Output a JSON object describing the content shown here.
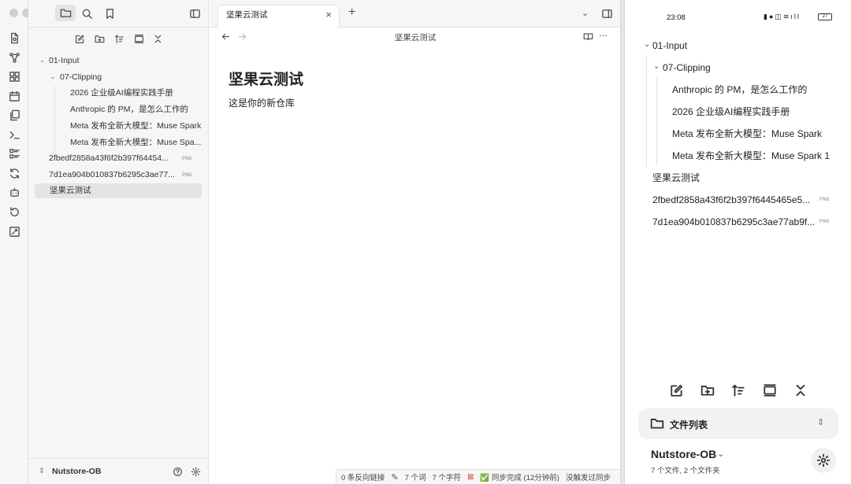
{
  "tab": {
    "title": "坚果云测试"
  },
  "note": {
    "header_title": "坚果云测试",
    "heading": "坚果云测试",
    "body": "这是你的新仓库"
  },
  "tree": {
    "folder1": "01-Input",
    "folder2": "07-Clipping",
    "files": [
      "2026 企业级AI编程实践手册",
      "Anthropic 的 PM，是怎么工作的",
      "Meta 发布全新大模型：Muse Spark",
      "Meta 发布全新大模型：Muse Spa..."
    ],
    "images": [
      {
        "name": "2fbedf2858a43f6f2b397f64454...",
        "ext": "PNG"
      },
      {
        "name": "7d1ea904b010837b6295c3ae77...",
        "ext": "PNG"
      }
    ],
    "selected": "坚果云测试"
  },
  "vault": {
    "name": "Nutstore-OB"
  },
  "status": {
    "backlinks": "0 条反向链接",
    "words": "7 个词",
    "chars": "7 个字符",
    "sync": "✅ 同步完成 (12分钟前)",
    "sync2": "没触发过同步"
  },
  "mobile": {
    "time": "23:08",
    "battery": "27",
    "folder1": "01-Input",
    "folder2": "07-Clipping",
    "files": [
      "Anthropic 的 PM，是怎么工作的",
      "2026 企业级AI编程实践手册",
      "Meta 发布全新大模型：Muse Spark",
      "Meta 发布全新大模型：Muse Spark 1"
    ],
    "root_note": "坚果云测试",
    "images": [
      {
        "name": "2fbedf2858a43f6f2b397f6445465e5...",
        "ext": "PNG"
      },
      {
        "name": "7d1ea904b010837b6295c3ae77ab9f...",
        "ext": "PNG"
      }
    ],
    "file_list_label": "文件列表",
    "vault_name": "Nutstore-OB",
    "vault_stats": "7 个文件, 2 个文件夹"
  },
  "icons": [
    "folder-icon",
    "search-icon",
    "bookmark-icon",
    "sidebar-toggle-icon",
    "new-note-icon",
    "new-folder-icon",
    "sort-icon",
    "collapse-icon",
    "back-icon",
    "forward-icon",
    "reading-view-icon",
    "more-icon",
    "settings-icon",
    "help-icon",
    "chevron-down-icon"
  ]
}
